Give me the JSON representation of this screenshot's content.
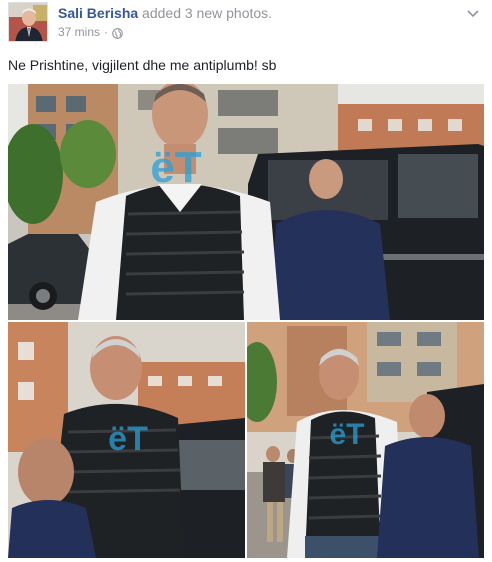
{
  "post": {
    "author": {
      "name": "Sali Berisha",
      "action": "added 3 new photos."
    },
    "meta": {
      "time": "37 mins",
      "separator": "·",
      "privacy_icon": "globe-icon"
    },
    "menu_icon": "chevron-down-icon",
    "text": "Ne Prishtine, vigjilent dhe me antiplumb! sb",
    "photos": [
      {
        "watermark": "ëT"
      },
      {
        "watermark": "ëT"
      },
      {
        "watermark": "ëT"
      }
    ]
  },
  "colors": {
    "author_link": "#365899",
    "meta_gray": "#90949c",
    "text": "#1d2129",
    "watermark": "#2aa0d6"
  }
}
